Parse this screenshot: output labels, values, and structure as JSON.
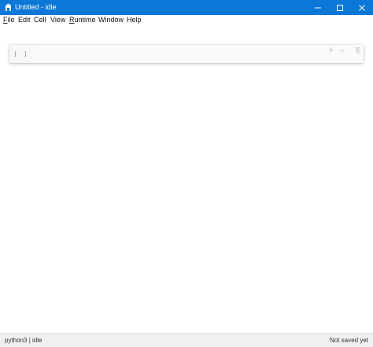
{
  "window": {
    "title": "Untitled - idle"
  },
  "menu": [
    {
      "id": "file",
      "accel": "F",
      "rest": "ile"
    },
    {
      "id": "edit",
      "accel": "",
      "rest": "Edit"
    },
    {
      "id": "cell",
      "accel": "",
      "rest": "Cell"
    },
    {
      "id": "view",
      "accel": "",
      "rest": "View"
    },
    {
      "id": "runtime",
      "accel": "R",
      "rest": "untime"
    },
    {
      "id": "window",
      "accel": "",
      "rest": "Window"
    },
    {
      "id": "help",
      "accel": "",
      "rest": "Help"
    }
  ],
  "cell": {
    "prompt": "[ ]",
    "source": ""
  },
  "status": {
    "kernel": "python3 | idle",
    "save_state": "Not saved yet"
  },
  "colors": {
    "titlebar": "#0b78d7",
    "statusbar": "#f0f0f0"
  },
  "icons": [
    "notebook-icon",
    "minimize-icon",
    "maximize-icon",
    "close-icon",
    "run-cell-icon",
    "cell-chevron-down-icon",
    "delete-cell-icon"
  ]
}
